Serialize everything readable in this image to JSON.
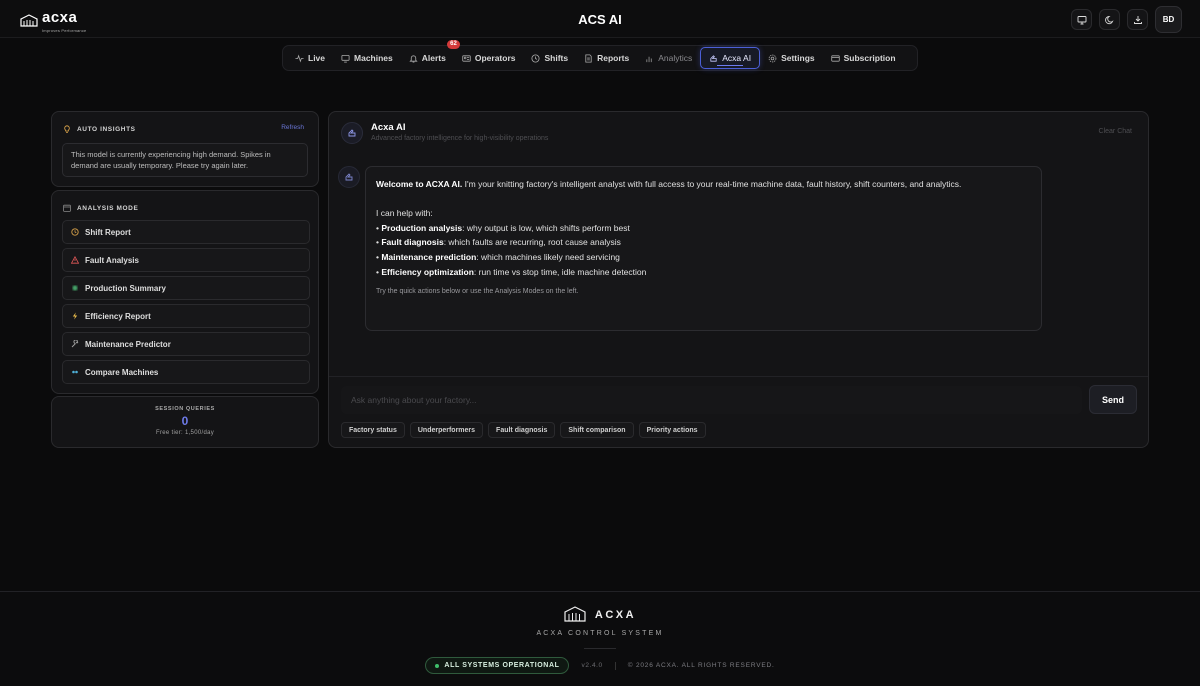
{
  "header": {
    "logo_text": "acxa",
    "logo_tagline": "Improves Performance",
    "title": "ACS AI",
    "avatar_initials": "BD"
  },
  "nav": {
    "items": [
      {
        "label": "Live",
        "icon": "pulse-icon"
      },
      {
        "label": "Machines",
        "icon": "monitor-icon"
      },
      {
        "label": "Alerts",
        "icon": "bell-icon",
        "badge": "62"
      },
      {
        "label": "Operators",
        "icon": "id-card-icon"
      },
      {
        "label": "Shifts",
        "icon": "clock-icon"
      },
      {
        "label": "Reports",
        "icon": "document-icon"
      },
      {
        "label": "Analytics",
        "icon": "bar-chart-icon"
      },
      {
        "label": "Acxa AI",
        "icon": "ai-spark-icon",
        "active": true
      },
      {
        "label": "Settings",
        "icon": "gear-icon"
      },
      {
        "label": "Subscription",
        "icon": "card-icon"
      }
    ]
  },
  "insights": {
    "title": "AUTO INSIGHTS",
    "refresh_label": "Refresh",
    "message": "This model is currently experiencing high demand. Spikes in demand are usually temporary. Please try again later."
  },
  "analysis_modes": {
    "title": "ANALYSIS MODE",
    "items": [
      {
        "label": "Shift Report",
        "icon": "clock-icon",
        "color": "#d8a24a"
      },
      {
        "label": "Fault Analysis",
        "icon": "warning-icon",
        "color": "#e05757"
      },
      {
        "label": "Production Summary",
        "icon": "grid-icon",
        "color": "#4fae73"
      },
      {
        "label": "Efficiency Report",
        "icon": "lightning-icon",
        "color": "#e6b94a"
      },
      {
        "label": "Maintenance Predictor",
        "icon": "wrench-icon",
        "color": "#9a9a9a"
      },
      {
        "label": "Compare Machines",
        "icon": "compare-icon",
        "color": "#4fb0d8"
      }
    ]
  },
  "session": {
    "label": "SESSION QUERIES",
    "count": "0",
    "tier": "Free tier: 1,500/day"
  },
  "chat": {
    "title": "Acxa AI",
    "subtitle": "Advanced factory intelligence for high-visibility operations",
    "clear_label": "Clear Chat",
    "welcome_bold": "Welcome to ACXA AI.",
    "welcome_rest": " I'm your knitting factory's intelligent analyst with full access to your real-time machine data, fault history, shift counters, and analytics.",
    "help_intro": "I can help with:",
    "help_items": [
      {
        "bold": "Production analysis",
        "rest": ": why output is low, which shifts perform best"
      },
      {
        "bold": "Fault diagnosis",
        "rest": ": which faults are recurring, root cause analysis"
      },
      {
        "bold": "Maintenance prediction",
        "rest": ": which machines likely need servicing"
      },
      {
        "bold": "Efficiency optimization",
        "rest": ": run time vs stop time, idle machine detection"
      }
    ],
    "hint": "Try the quick actions below or use the Analysis Modes on the left.",
    "input_placeholder": "Ask anything about your factory...",
    "send_label": "Send",
    "quick_actions": [
      "Factory status",
      "Underperformers",
      "Fault diagnosis",
      "Shift comparison",
      "Priority actions"
    ]
  },
  "footer": {
    "brand": "ACXA",
    "subtitle": "ACXA CONTROL SYSTEM",
    "status": "ALL SYSTEMS OPERATIONAL",
    "version": "v2.4.0",
    "copyright": "© 2026 ACXA. ALL RIGHTS RESERVED."
  },
  "colors": {
    "accent": "#5b6be0",
    "badge": "#d33a3a",
    "status_ok": "#3fbf6a"
  }
}
